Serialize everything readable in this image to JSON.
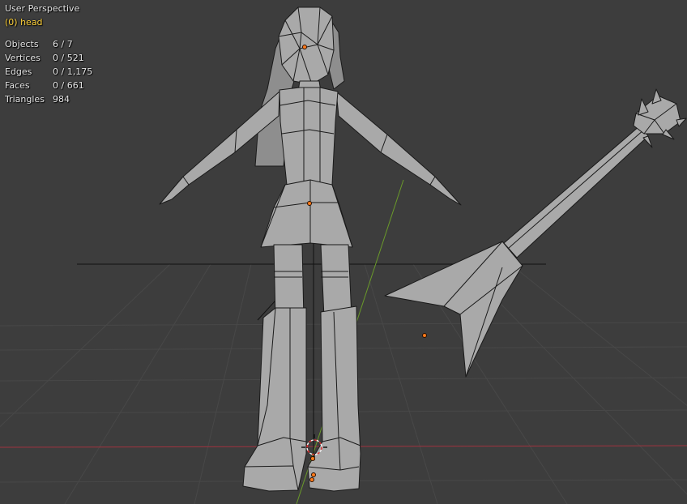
{
  "viewport": {
    "view_name": "User Perspective",
    "active_object": "(0) head",
    "stats": [
      {
        "label": "Objects",
        "value": "6 / 7"
      },
      {
        "label": "Vertices",
        "value": "0 / 521"
      },
      {
        "label": "Edges",
        "value": "0 / 1,175"
      },
      {
        "label": "Faces",
        "value": "0 / 661"
      },
      {
        "label": "Triangles",
        "value": "984"
      }
    ]
  },
  "colors": {
    "background": "#3d3d3d",
    "grid": "#4a4a4a",
    "x_axis": "#a0333f",
    "y_axis": "#6a9a2a",
    "mesh_fill": "#a8a8a8",
    "mesh_wire": "#1a1a1a",
    "origin_point": "#ff7a1a",
    "active_text": "#ffd23a"
  },
  "scene_objects": [
    "head",
    "body",
    "arm-left",
    "arm-right",
    "skirt",
    "legs",
    "guitar"
  ]
}
